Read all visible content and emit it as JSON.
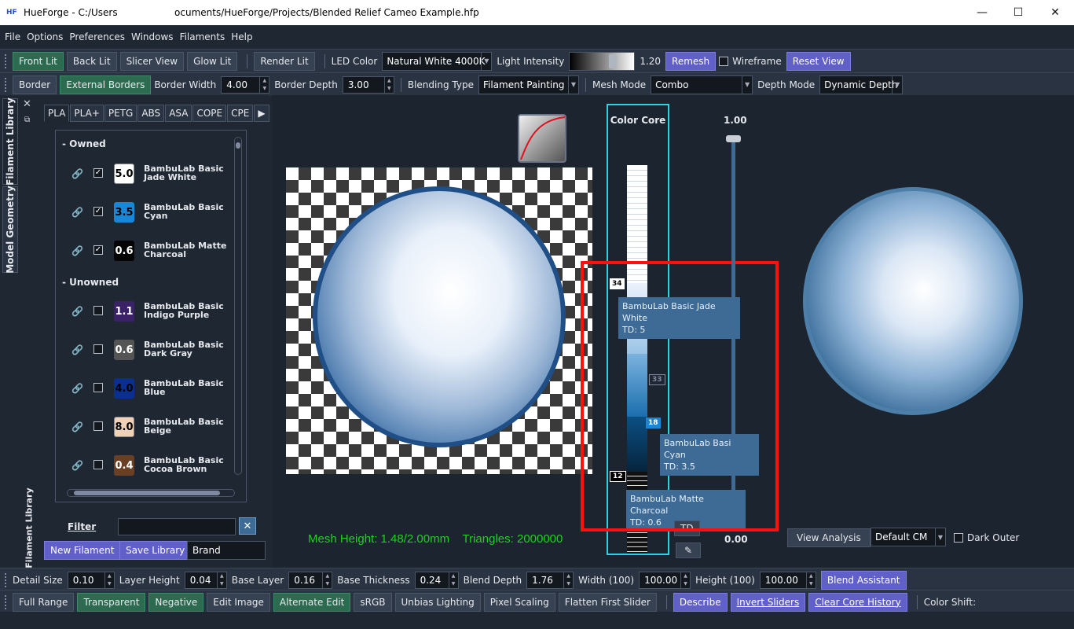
{
  "window": {
    "title": "HueForge - C:/Users                   ocuments/HueForge/Projects/Blended Relief Cameo Example.hfp",
    "minimize": "—",
    "maximize": "☐",
    "close": "✕"
  },
  "menu": [
    "File",
    "Options",
    "Preferences",
    "Windows",
    "Filaments",
    "Help"
  ],
  "toolbar1": {
    "front_lit": "Front Lit",
    "back_lit": "Back Lit",
    "slicer_view": "Slicer View",
    "glow_lit": "Glow Lit",
    "render_lit": "Render Lit",
    "led_color_label": "LED Color",
    "led_color_value": "Natural White 4000K",
    "light_intensity_label": "Light Intensity",
    "light_intensity_value": "1.20",
    "remesh": "Remesh",
    "wireframe": "Wireframe",
    "reset_view": "Reset View"
  },
  "toolbar2": {
    "border": "Border",
    "external_borders": "External Borders",
    "border_width_label": "Border Width",
    "border_width_value": "4.00",
    "border_depth_label": "Border Depth",
    "border_depth_value": "3.00",
    "blending_type_label": "Blending Type",
    "blending_type_value": "Filament Painting",
    "mesh_mode_label": "Mesh Mode",
    "mesh_mode_value": "Combo",
    "depth_mode_label": "Depth Mode",
    "depth_mode_value": "Dynamic Depth"
  },
  "side_tabs": {
    "filament_library": "Filament Library",
    "model_geometry": "Model Geometry"
  },
  "library": {
    "tabs": [
      "PLA",
      "PLA+",
      "PETG",
      "ABS",
      "ASA",
      "COPE",
      "CPE"
    ],
    "owned_header": "- Owned",
    "unowned_header": "- Unowned",
    "owned": [
      {
        "td": "5.0",
        "name1": "BambuLab Basic",
        "name2": "Jade White",
        "color": "#ffffff",
        "text": "#000000",
        "checked": true
      },
      {
        "td": "3.5",
        "name1": "BambuLab Basic",
        "name2": "Cyan",
        "color": "#1a86d6",
        "text": "#000000",
        "checked": true
      },
      {
        "td": "0.6",
        "name1": "BambuLab Matte",
        "name2": "Charcoal",
        "color": "#050505",
        "text": "#ffffff",
        "checked": true
      }
    ],
    "unowned": [
      {
        "td": "1.1",
        "name1": "BambuLab Basic",
        "name2": "Indigo Purple",
        "color": "#3b2266",
        "text": "#ffffff",
        "checked": false
      },
      {
        "td": "0.6",
        "name1": "BambuLab Basic",
        "name2": "Dark Gray",
        "color": "#555555",
        "text": "#ffffff",
        "checked": false
      },
      {
        "td": "4.0",
        "name1": "BambuLab Basic",
        "name2": "Blue",
        "color": "#0b2f8c",
        "text": "#000000",
        "checked": false
      },
      {
        "td": "8.0",
        "name1": "BambuLab Basic",
        "name2": "Beige",
        "color": "#efd2b8",
        "text": "#000000",
        "checked": false
      },
      {
        "td": "0.4",
        "name1": "BambuLab Basic",
        "name2": "Cocoa Brown",
        "color": "#6a4024",
        "text": "#ffffff",
        "checked": false
      }
    ],
    "filter_label": "Filter",
    "new_filament": "New Filament",
    "save_library": "Save Library",
    "brand_placeholder": "Brand",
    "vertical_label": "Filament Library"
  },
  "viewport": {
    "mesh_height": "Mesh Height: 1.48/2.00mm",
    "triangles": "Triangles: 2000000",
    "color_core_label": "Color Core",
    "slider_top": "1.00",
    "slider_bottom": "0.00",
    "marker_34": "34",
    "marker_33": "33",
    "marker_18": "18",
    "marker_12": "12",
    "td_button": "TD",
    "tooltips": [
      {
        "title": "BambuLab Basic Jade White",
        "td": "TD: 5"
      },
      {
        "title": "BambuLab Basic Cyan",
        "td": "TD: 3.5"
      },
      {
        "title": "BambuLab Matte Charcoal",
        "td": "TD: 0.6"
      }
    ],
    "view_analysis": "View Analysis",
    "default_cm": "Default CM",
    "dark_outer": "Dark Outer"
  },
  "toolbar3": {
    "detail_size_label": "Detail Size",
    "detail_size_value": "0.10",
    "layer_height_label": "Layer Height",
    "layer_height_value": "0.04",
    "base_layer_label": "Base Layer",
    "base_layer_value": "0.16",
    "base_thickness_label": "Base Thickness",
    "base_thickness_value": "0.24",
    "blend_depth_label": "Blend Depth",
    "blend_depth_value": "1.76",
    "width_label": "Width (100)",
    "width_value": "100.00",
    "height_label": "Height (100)",
    "height_value": "100.00",
    "blend_assistant": "Blend Assistant"
  },
  "toolbar4": {
    "full_range": "Full Range",
    "transparent": "Transparent",
    "negative": "Negative",
    "edit_image": "Edit Image",
    "alternate_edit": "Alternate Edit",
    "srgb": "sRGB",
    "unbias_lighting": "Unbias Lighting",
    "pixel_scaling": "Pixel Scaling",
    "flatten_first_slider": "Flatten First Slider",
    "describe": "Describe",
    "invert_sliders": "Invert Sliders",
    "clear_core_history": "Clear Core History",
    "color_shift": "Color Shift:"
  },
  "colors": {
    "accent_purple": "#6160c9",
    "accent_green": "#2c6b4f",
    "cyan_frame": "#2ad4e0",
    "highlight_red": "#ff1010",
    "mesh_info_green": "#20d020",
    "tooltip_blue": "#3d6b95"
  }
}
